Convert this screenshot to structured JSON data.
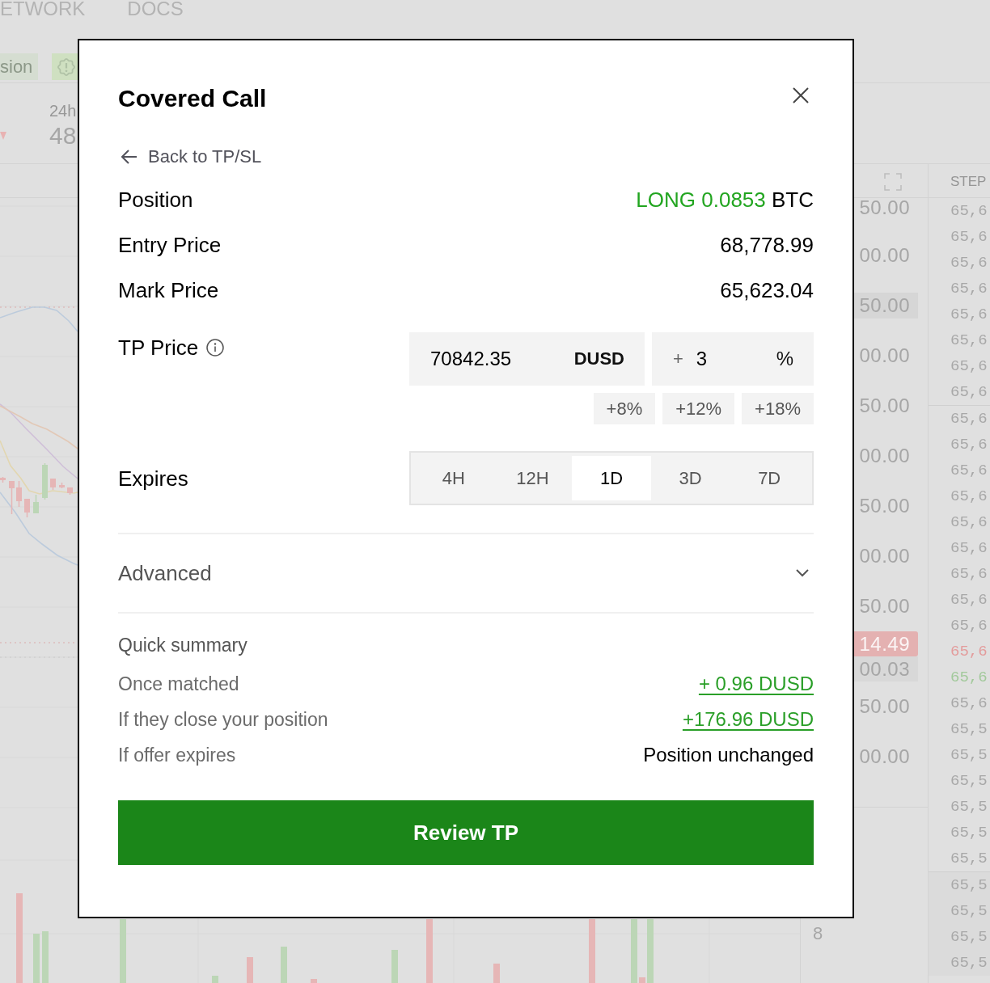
{
  "background": {
    "nav_links": [
      "ETWORK",
      "DOCS"
    ],
    "toolbar": {
      "tag": "sion"
    },
    "stat": {
      "label": "24h",
      "value": "48"
    },
    "price_axis": [
      {
        "text": "50.00",
        "kind": "tick"
      },
      {
        "text": "00.00",
        "kind": "tick"
      },
      {
        "text": "50.00",
        "kind": "highlight"
      },
      {
        "text": "00.00",
        "kind": "tick"
      },
      {
        "text": "50.00",
        "kind": "tick"
      },
      {
        "text": "00.00",
        "kind": "tick"
      },
      {
        "text": "50.00",
        "kind": "tick"
      },
      {
        "text": "00.00",
        "kind": "tick"
      },
      {
        "text": "50.00",
        "kind": "tick"
      },
      {
        "text": "14.49",
        "kind": "current"
      },
      {
        "text": "00.03",
        "kind": "marker"
      },
      {
        "text": "50.00",
        "kind": "tick"
      },
      {
        "text": "00.00",
        "kind": "tick"
      }
    ],
    "volume_axis": [
      "8"
    ],
    "order_book": {
      "header": "STEP",
      "sections": [
        {
          "rows": [
            {
              "price": "65,6",
              "color": "#a8a8a8"
            },
            {
              "price": "65,6",
              "color": "#a8a8a8"
            },
            {
              "price": "65,6",
              "color": "#a8a8a8"
            },
            {
              "price": "65,6",
              "color": "#a8a8a8"
            },
            {
              "price": "65,6",
              "color": "#a8a8a8"
            },
            {
              "price": "65,6",
              "color": "#a8a8a8"
            },
            {
              "price": "65,6",
              "color": "#a8a8a8"
            },
            {
              "price": "65,6",
              "color": "#a8a8a8"
            }
          ]
        },
        {
          "rows": [
            {
              "price": "65,6",
              "color": "#a8a8a8"
            },
            {
              "price": "65,6",
              "color": "#a8a8a8"
            },
            {
              "price": "65,6",
              "color": "#a8a8a8"
            },
            {
              "price": "65,6",
              "color": "#a8a8a8"
            },
            {
              "price": "65,6",
              "color": "#a8a8a8"
            },
            {
              "price": "65,6",
              "color": "#a8a8a8"
            },
            {
              "price": "65,6",
              "color": "#a8a8a8"
            },
            {
              "price": "65,6",
              "color": "#a8a8a8"
            },
            {
              "price": "65,6",
              "color": "#a8a8a8"
            },
            {
              "price": "65,6",
              "color": "#e39c9c"
            },
            {
              "price": "65,6",
              "color": "#a2c99b"
            },
            {
              "price": "65,6",
              "color": "#a8a8a8"
            },
            {
              "price": "65,5",
              "color": "#a8a8a8"
            },
            {
              "price": "65,5",
              "color": "#a8a8a8"
            },
            {
              "price": "65,5",
              "color": "#a8a8a8"
            },
            {
              "price": "65,5",
              "color": "#a8a8a8"
            },
            {
              "price": "65,5",
              "color": "#a8a8a8"
            },
            {
              "price": "65,5",
              "color": "#a8a8a8"
            }
          ]
        },
        {
          "rows": [
            {
              "price": "65,5",
              "color": "#a8a8a8"
            },
            {
              "price": "65,5",
              "color": "#a8a8a8"
            },
            {
              "price": "65,5",
              "color": "#a8a8a8"
            },
            {
              "price": "65,5",
              "color": "#a8a8a8"
            }
          ]
        }
      ]
    }
  },
  "modal": {
    "title": "Covered Call",
    "back_link": "Back to TP/SL",
    "details": [
      {
        "kind": "position",
        "label": "Position",
        "value": "LONG 0.0853",
        "unit": "BTC"
      },
      {
        "kind": "plain",
        "label": "Entry Price",
        "value": "68,778.99"
      },
      {
        "kind": "plain",
        "label": "Mark Price",
        "value": "65,623.04"
      }
    ],
    "tp_price": {
      "label": "TP Price",
      "price_field": {
        "value": "70842.35",
        "unit": "DUSD"
      },
      "percent_field": {
        "sign": "+",
        "value": "3",
        "unit": "%"
      },
      "presets": [
        "+8%",
        "+12%",
        "+18%"
      ]
    },
    "expires": {
      "label": "Expires",
      "options": [
        {
          "label": "4H",
          "selected": false
        },
        {
          "label": "12H",
          "selected": false
        },
        {
          "label": "1D",
          "selected": true
        },
        {
          "label": "3D",
          "selected": false
        },
        {
          "label": "7D",
          "selected": false
        }
      ]
    },
    "advanced": {
      "label": "Advanced",
      "expanded": false
    },
    "summary": {
      "title": "Quick summary",
      "rows": [
        {
          "kind": "link",
          "label": "Once matched",
          "value": "+ 0.96 DUSD"
        },
        {
          "kind": "link",
          "label": "If they close your position",
          "value": "+176.96 DUSD"
        },
        {
          "kind": "text",
          "label": "If offer expires",
          "value": "Position unchanged"
        }
      ]
    },
    "submit": "Review TP"
  }
}
